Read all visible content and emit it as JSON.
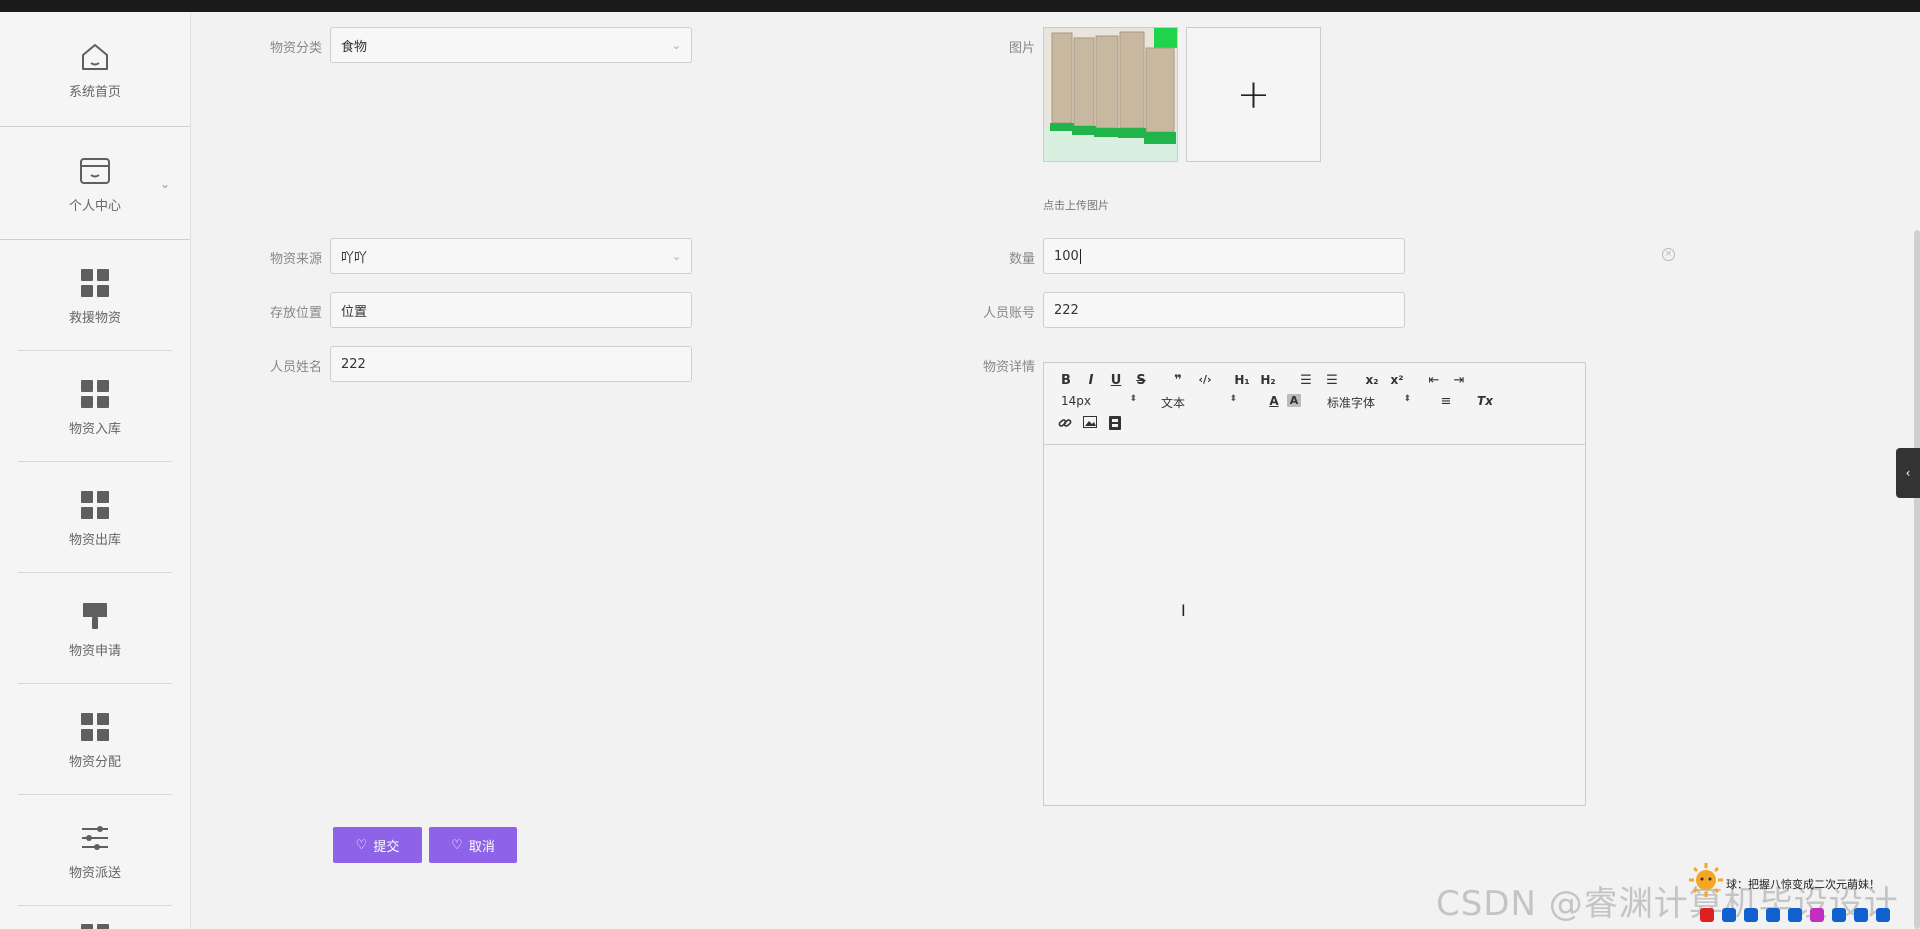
{
  "sidebar": {
    "items": [
      {
        "label": "系统首页",
        "icon": "home-icon"
      },
      {
        "label": "个人中心",
        "icon": "card-icon"
      },
      {
        "label": "救援物资",
        "icon": "grid-icon"
      },
      {
        "label": "物资入库",
        "icon": "grid-icon"
      },
      {
        "label": "物资出库",
        "icon": "grid-icon"
      },
      {
        "label": "物资申请",
        "icon": "brush-icon"
      },
      {
        "label": "物资分配",
        "icon": "grid-icon"
      },
      {
        "label": "物资派送",
        "icon": "sliders-icon"
      }
    ]
  },
  "form": {
    "category": {
      "label": "物资分类",
      "value": "食物"
    },
    "image": {
      "label": "图片",
      "tip": "点击上传图片"
    },
    "source": {
      "label": "物资来源",
      "value": "吖吖"
    },
    "quantity": {
      "label": "数量",
      "value": "100"
    },
    "location": {
      "label": "存放位置",
      "value": "位置"
    },
    "account": {
      "label": "人员账号",
      "value": "222"
    },
    "name": {
      "label": "人员姓名",
      "value": "222"
    },
    "details": {
      "label": "物资详情"
    }
  },
  "editor": {
    "font_size": "14px",
    "format": "文本",
    "font_family": "标准字体",
    "buttons": {
      "bold": "B",
      "italic": "I",
      "underline": "U",
      "strike": "S",
      "quote": "❞",
      "code": "‹/›",
      "h1": "H₁",
      "h2": "H₂",
      "ol": "☰",
      "ul": "☰",
      "sub": "x₂",
      "sup": "x²",
      "outdent": "⇤",
      "indent": "⇥",
      "color": "A",
      "bg": "A",
      "align": "≡",
      "clean": "Tx"
    }
  },
  "actions": {
    "submit": "提交",
    "cancel": "取消"
  },
  "overlay": {
    "watermark": "CSDN @睿渊计算机毕设设计",
    "widget_text": "球：把握八惊变成二次元萌妹！"
  },
  "colors": {
    "accent": "#8f63e8"
  }
}
